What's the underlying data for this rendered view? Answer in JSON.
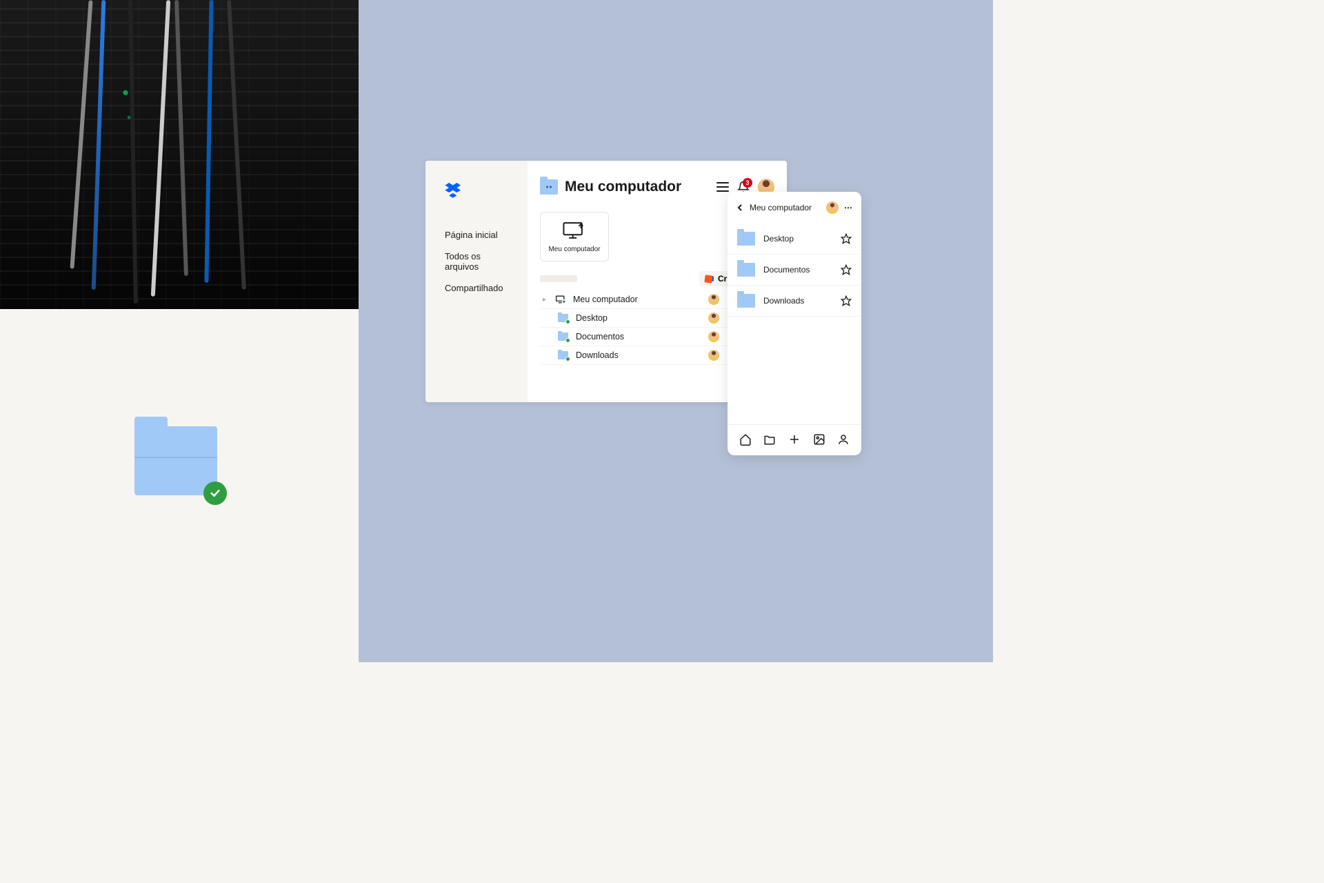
{
  "desktop": {
    "title": "Meu computador",
    "sidebar": {
      "items": [
        {
          "label": "Página inicial"
        },
        {
          "label": "Todos os arquivos"
        },
        {
          "label": "Compartilhado"
        }
      ]
    },
    "tile_label": "Meu computador",
    "create_label": "Criar",
    "notification_count": "3",
    "rows": [
      {
        "label": "Meu computador"
      },
      {
        "label": "Desktop"
      },
      {
        "label": "Documentos"
      },
      {
        "label": "Downloads"
      }
    ]
  },
  "mobile": {
    "title": "Meu computador",
    "rows": [
      {
        "label": "Desktop"
      },
      {
        "label": "Documentos"
      },
      {
        "label": "Downloads"
      }
    ]
  }
}
